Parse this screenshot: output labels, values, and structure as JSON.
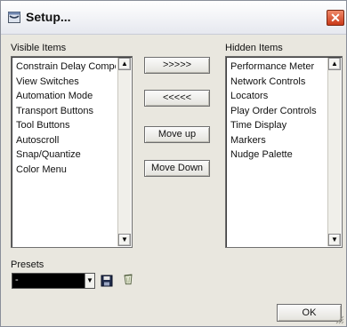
{
  "window": {
    "title": "Setup...",
    "close_glyph": "✕",
    "icon": "window-setup-icon"
  },
  "visible": {
    "label": "Visible Items",
    "items": [
      "Constrain Delay Compensation",
      "View Switches",
      "Automation Mode",
      "Transport Buttons",
      "Tool Buttons",
      "Autoscroll",
      "Snap/Quantize",
      "Color Menu"
    ]
  },
  "hidden": {
    "label": "Hidden Items",
    "items": [
      "Performance Meter",
      "Network Controls",
      "Locators",
      "Play Order Controls",
      "Time Display",
      "Markers",
      "Nudge Palette"
    ]
  },
  "buttons": {
    "move_right": ">>>>>",
    "move_left": "<<<<<",
    "move_up": "Move up",
    "move_down": "Move Down",
    "ok": "OK"
  },
  "presets": {
    "label": "Presets",
    "value": "-",
    "save_icon": "save-icon",
    "delete_icon": "trash-icon"
  },
  "scroll_glyphs": {
    "up": "▲",
    "down": "▼"
  },
  "colors": {
    "background": "#e9e7df",
    "close_button": "#d9502c",
    "combo_background": "#000000"
  }
}
